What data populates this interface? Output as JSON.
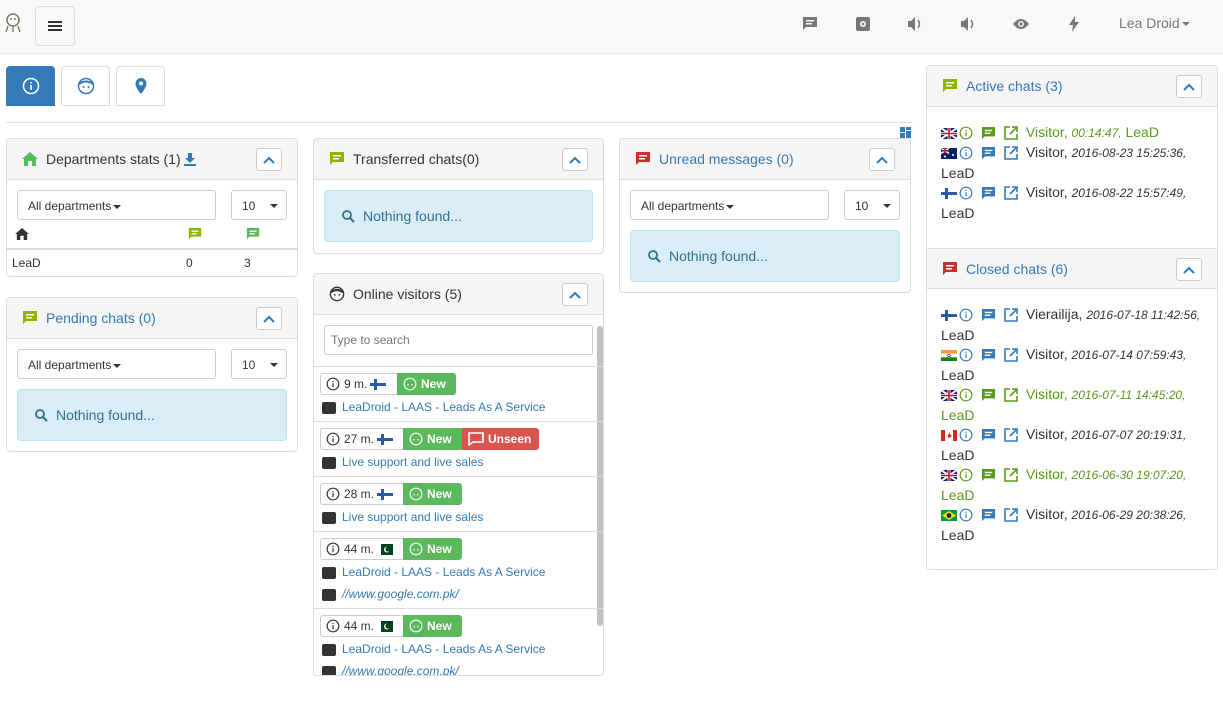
{
  "header": {
    "user_name": "Lea Droid"
  },
  "departments": {
    "title": "Departments stats (1)",
    "filter": "All departments",
    "limit": "10",
    "rows": [
      {
        "name": "LeaD",
        "active": "0",
        "total": "3"
      }
    ]
  },
  "transferred": {
    "title": "Transferred chats(0)",
    "empty": "Nothing found..."
  },
  "unread": {
    "title": "Unread messages (0)",
    "filter": "All departments",
    "limit": "10",
    "empty": "Nothing found..."
  },
  "pending": {
    "title": "Pending chats (0)",
    "filter": "All departments",
    "limit": "10",
    "empty": "Nothing found..."
  },
  "online": {
    "title": "Online visitors (5)",
    "search_placeholder": "Type to search",
    "visitors": [
      {
        "time": "9 m.",
        "badge": "New",
        "unseen": "",
        "page": "LeaDroid - LAAS - Leads As A Service",
        "ref": ""
      },
      {
        "time": "27 m.",
        "badge": "New",
        "unseen": "Unseen",
        "page": "Live support and live sales",
        "ref": ""
      },
      {
        "time": "28 m.",
        "badge": "New",
        "unseen": "",
        "page": "Live support and live sales",
        "ref": ""
      },
      {
        "time": "44 m.",
        "badge": "New",
        "unseen": "",
        "page": "LeaDroid - LAAS - Leads As A Service",
        "ref": "//www.google.com.pk/"
      },
      {
        "time": "44 m.",
        "badge": "New",
        "unseen": "",
        "page": "LeaDroid - LAAS - Leads As A Service",
        "ref": "//www.google.com.pk/"
      }
    ]
  },
  "active": {
    "title": "Active chats (3)",
    "chats": [
      {
        "name": "Visitor,",
        "time": "00:14:47,",
        "op": "LeaD"
      },
      {
        "name": "Visitor,",
        "time": "2016-08-23 15:25:36,",
        "op": "LeaD"
      },
      {
        "name": "Visitor,",
        "time": "2016-08-22 15:57:49,",
        "op": "LeaD"
      }
    ]
  },
  "closed": {
    "title": "Closed chats (6)",
    "chats": [
      {
        "name": "Vierailija,",
        "time": "2016-07-18 11:42:56,",
        "op": "LeaD"
      },
      {
        "name": "Visitor,",
        "time": "2016-07-14 07:59:43,",
        "op": "LeaD"
      },
      {
        "name": "Visitor,",
        "time": "2016-07-11 14:45:20,",
        "op": "LeaD"
      },
      {
        "name": "Visitor,",
        "time": "2016-07-07 20:19:31,",
        "op": "LeaD"
      },
      {
        "name": "Visitor,",
        "time": "2016-06-30 19:07:20,",
        "op": "LeaD"
      },
      {
        "name": "Visitor,",
        "time": "2016-06-29 20:38:26,",
        "op": "LeaD"
      }
    ]
  },
  "colors": {
    "primary": "#337ab7",
    "green": "#5cb85c",
    "olive": "#8db500",
    "red": "#d9534f",
    "info_bg": "#d9edf7"
  }
}
